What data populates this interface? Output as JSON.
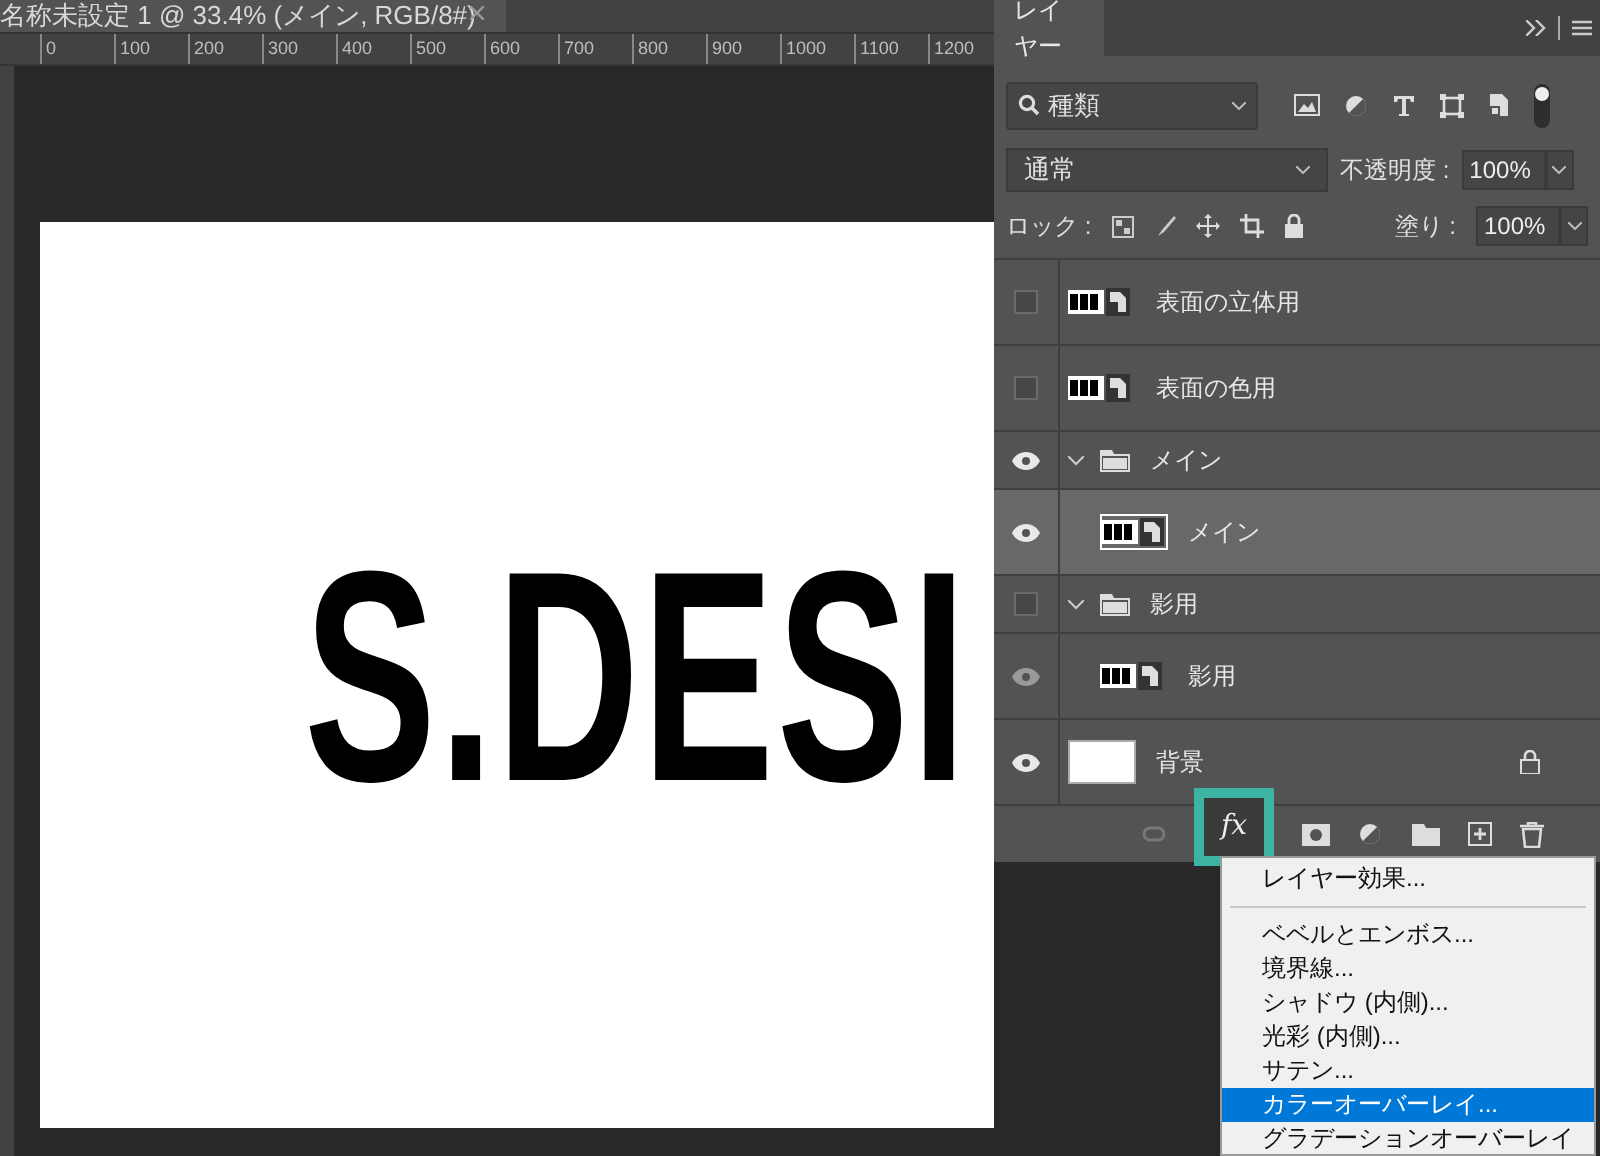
{
  "document": {
    "tab_title": "名称未設定 1 @ 33.4% (メイン, RGB/8#)",
    "ruler_marks": [
      "0",
      "100",
      "200",
      "300",
      "400",
      "500",
      "600",
      "700",
      "800",
      "900",
      "1000",
      "1100",
      "1200"
    ],
    "canvas_text": "S.DESI"
  },
  "layers_panel": {
    "tab": "レイヤー",
    "filter": "種類",
    "blend_mode": "通常",
    "opacity_label": "不透明度 :",
    "opacity": "100%",
    "lock_label": "ロック :",
    "fill_label": "塗り :",
    "fill": "100%",
    "fx_button": "fx",
    "layers": [
      {
        "kind": "smart",
        "name": "表面の立体用",
        "visible": false,
        "selected": false
      },
      {
        "kind": "smart",
        "name": "表面の色用",
        "visible": false,
        "selected": false
      },
      {
        "kind": "group",
        "name": "メイン",
        "visible": true,
        "selected": false,
        "children": [
          {
            "kind": "smart",
            "name": "メイン",
            "visible": true,
            "selected": true
          }
        ]
      },
      {
        "kind": "group",
        "name": "影用",
        "visible": false,
        "selected": false,
        "children": [
          {
            "kind": "smart",
            "name": "影用",
            "visible": true,
            "selected": false
          }
        ]
      },
      {
        "kind": "background",
        "name": "背景",
        "visible": true,
        "selected": false,
        "locked": true
      }
    ]
  },
  "fx_menu": {
    "items": [
      {
        "label": "レイヤー効果...",
        "selected": false,
        "separator_after": true
      },
      {
        "label": "ベベルとエンボス...",
        "selected": false
      },
      {
        "label": "境界線...",
        "selected": false
      },
      {
        "label": "シャドウ (内側)...",
        "selected": false
      },
      {
        "label": "光彩 (内側)...",
        "selected": false
      },
      {
        "label": "サテン...",
        "selected": false
      },
      {
        "label": "カラーオーバーレイ...",
        "selected": true
      },
      {
        "label": "グラデーションオーバーレイ",
        "selected": false
      }
    ]
  }
}
